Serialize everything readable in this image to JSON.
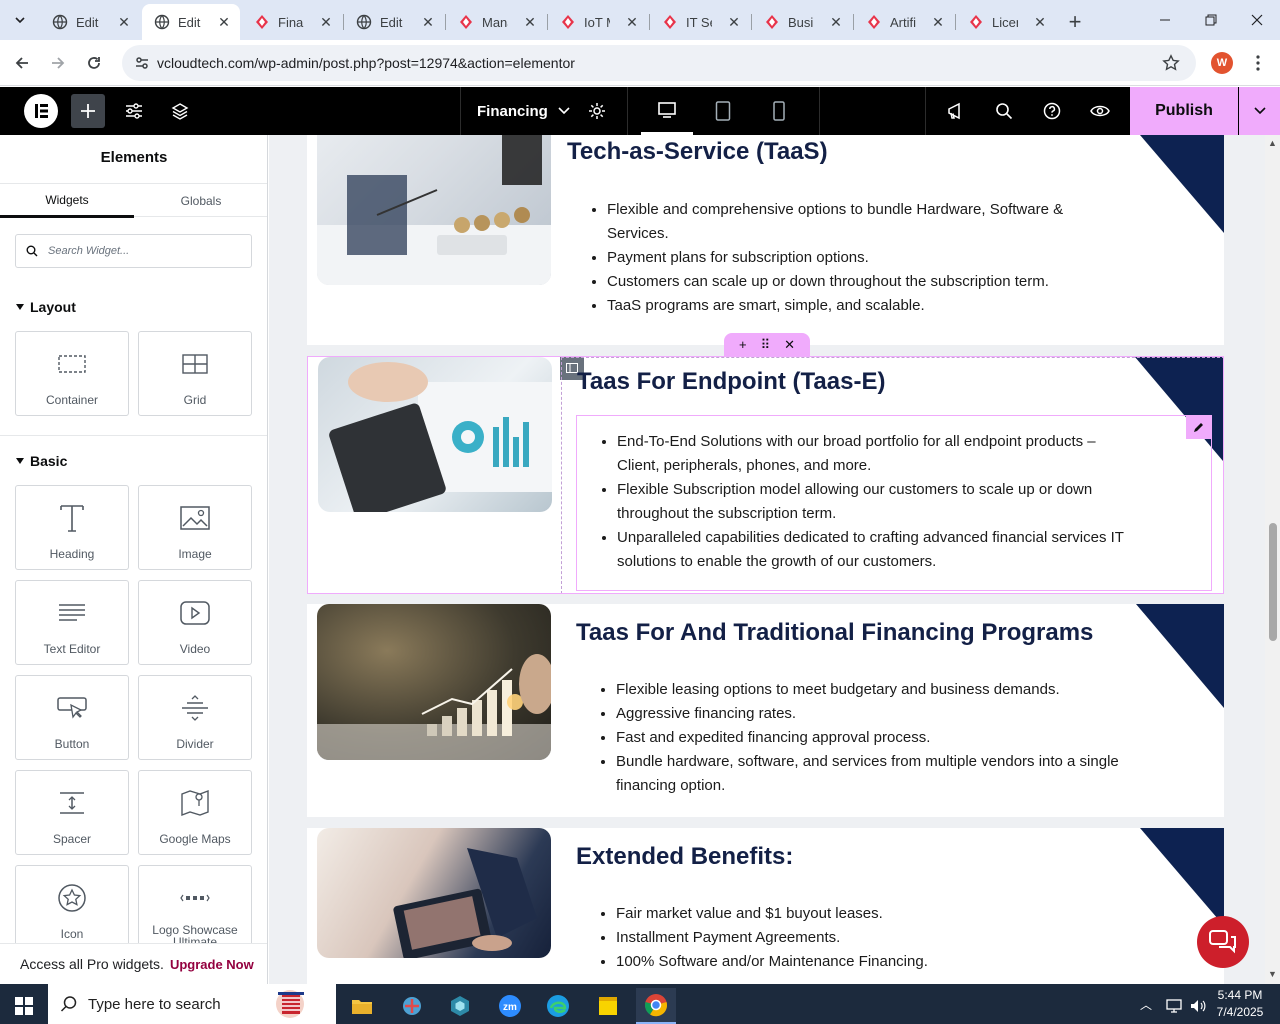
{
  "browser": {
    "tabs": [
      {
        "title": "Edit “("
      },
      {
        "title": "Edit “I"
      },
      {
        "title": "Finan"
      },
      {
        "title": "Edit “I"
      },
      {
        "title": "Mana"
      },
      {
        "title": "IoT M"
      },
      {
        "title": "IT Ser"
      },
      {
        "title": "Busin"
      },
      {
        "title": "Artific"
      },
      {
        "title": "Licens"
      }
    ],
    "url": "vcloudtech.com/wp-admin/post.php?post=12974&action=elementor",
    "profile_initial": "W"
  },
  "elementor": {
    "page_name": "Financing",
    "publish_label": "Publish"
  },
  "panel": {
    "title": "Elements",
    "tabs": [
      "Widgets",
      "Globals"
    ],
    "search_placeholder": "Search Widget...",
    "layout_label": "Layout",
    "basic_label": "Basic",
    "layout_widgets": [
      "Container",
      "Grid"
    ],
    "basic_widgets": [
      "Heading",
      "Image",
      "Text Editor",
      "Video",
      "Button",
      "Divider",
      "Spacer",
      "Google Maps",
      "Icon",
      "Logo Showcase Ultimate"
    ],
    "pro_text": "Access all Pro widgets.",
    "upgrade_label": "Upgrade Now"
  },
  "content": {
    "sections": [
      {
        "title": "Tech-as-Service (TaaS)",
        "items": [
          "Flexible and comprehensive options to bundle Hardware, Software & Services.",
          "Payment plans for subscription options.",
          "Customers can scale up or down throughout the subscription term.",
          "TaaS programs are smart, simple, and scalable."
        ]
      },
      {
        "title": "Taas For Endpoint (Taas-E)",
        "items": [
          "End-To-End Solutions with our broad portfolio for all endpoint products – Client, peripherals, phones, and more.",
          "Flexible Subscription model allowing our customers to scale up or down throughout the subscription term.",
          "Unparalleled capabilities dedicated to crafting advanced financial services IT solutions to enable the growth of our customers."
        ]
      },
      {
        "title": "Taas For And Traditional Financing Programs",
        "items": [
          "Flexible leasing options to meet budgetary and business demands.",
          "Aggressive financing rates.",
          "Fast and expedited financing approval process.",
          "Bundle hardware, software, and services from multiple vendors into a single financing option."
        ]
      },
      {
        "title": "Extended Benefits:",
        "items": [
          "Fair market value and $1 buyout leases.",
          "Installment Payment Agreements.",
          "100% Software and/or Maintenance Financing."
        ]
      }
    ]
  },
  "taskbar": {
    "search_placeholder": "Type here to search",
    "time": "5:44 PM",
    "date": "7/4/2025"
  },
  "colors": {
    "accent": "#f0abfc",
    "navy": "#0d2251",
    "heading": "#132046"
  }
}
